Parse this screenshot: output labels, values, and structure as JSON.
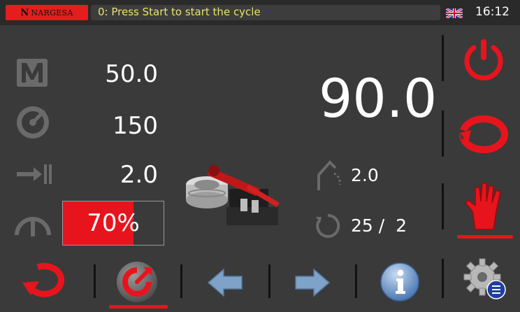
{
  "header": {
    "brand": "NARGESA",
    "brand_mark": "N",
    "status": "0: Press Start to start the cycle",
    "language_icon": "uk-flag-icon",
    "time": "16:12"
  },
  "parameters": {
    "m_value": "50.0",
    "speed_value": "150",
    "feed_value": "2.0",
    "progress_label": "70%",
    "progress_fraction": 0.7
  },
  "main": {
    "angle": "90.0",
    "springback": "2.0",
    "counter": "25 /  2"
  },
  "colors": {
    "accent_red": "#e8141d",
    "status_yellow": "#e8e36a",
    "background": "#3a3a3a"
  },
  "icons": {
    "m_param": "m-letter-icon",
    "speed": "speedometer-icon",
    "feed": "feed-arrow-icon",
    "pressure": "arch-icon",
    "springback": "springback-arc-icon",
    "counter": "counter-cycle-icon",
    "power": "power-icon",
    "reset_cycle": "reset-cycle-icon",
    "manual_mode": "hand-icon",
    "return": "return-icon",
    "bend_mode": "bend-mode-icon",
    "prev": "arrow-left-icon",
    "next": "arrow-right-icon",
    "info": "info-icon",
    "settings": "settings-gear-icon"
  }
}
